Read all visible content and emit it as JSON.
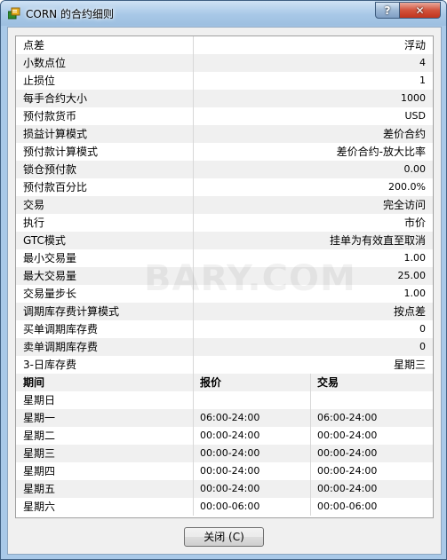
{
  "window": {
    "title": "CORN 的合约细则",
    "help_label": "?",
    "close_label": "✕",
    "icon": "app-icon"
  },
  "properties": [
    {
      "label": "点差",
      "value": "浮动"
    },
    {
      "label": "小数点位",
      "value": "4"
    },
    {
      "label": "止损位",
      "value": "1"
    },
    {
      "label": "每手合约大小",
      "value": "1000"
    },
    {
      "label": "预付款货币",
      "value": "USD"
    },
    {
      "label": "损益计算模式",
      "value": "差价合约"
    },
    {
      "label": "预付款计算模式",
      "value": "差价合约-放大比率"
    },
    {
      "label": "锁仓预付款",
      "value": "0.00"
    },
    {
      "label": "预付款百分比",
      "value": "200.0%"
    },
    {
      "label": "交易",
      "value": "完全访问"
    },
    {
      "label": "执行",
      "value": "市价"
    },
    {
      "label": "GTC模式",
      "value": "挂单为有效直至取消"
    },
    {
      "label": "最小交易量",
      "value": "1.00"
    },
    {
      "label": "最大交易量",
      "value": "25.00"
    },
    {
      "label": "交易量步长",
      "value": "1.00"
    },
    {
      "label": "调期库存费计算模式",
      "value": "按点差"
    },
    {
      "label": "买单调期库存费",
      "value": "0"
    },
    {
      "label": "卖单调期库存费",
      "value": "0"
    },
    {
      "label": "3-日库存费",
      "value": "星期三"
    }
  ],
  "sessions": {
    "headers": [
      "期间",
      "报价",
      "交易"
    ],
    "rows": [
      {
        "day": "星期日",
        "quote": "",
        "trade": ""
      },
      {
        "day": "星期一",
        "quote": "06:00-24:00",
        "trade": "06:00-24:00"
      },
      {
        "day": "星期二",
        "quote": "00:00-24:00",
        "trade": "00:00-24:00"
      },
      {
        "day": "星期三",
        "quote": "00:00-24:00",
        "trade": "00:00-24:00"
      },
      {
        "day": "星期四",
        "quote": "00:00-24:00",
        "trade": "00:00-24:00"
      },
      {
        "day": "星期五",
        "quote": "00:00-24:00",
        "trade": "00:00-24:00"
      },
      {
        "day": "星期六",
        "quote": "00:00-06:00",
        "trade": "00:00-06:00"
      }
    ]
  },
  "watermark": "BARY.COM",
  "buttons": {
    "close_label": "关闭 (C)"
  }
}
